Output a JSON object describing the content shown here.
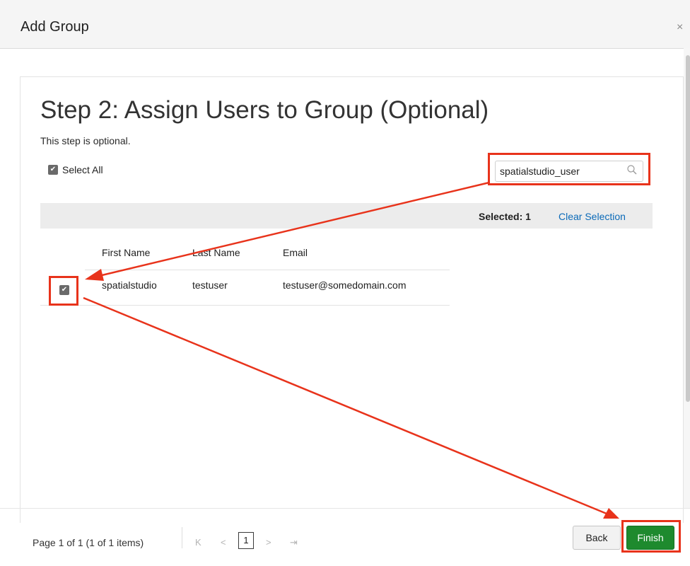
{
  "dialog": {
    "title": "Add Group",
    "close_label": "×"
  },
  "step": {
    "title": "Step 2: Assign Users to Group (Optional)",
    "subtitle": "This step is optional."
  },
  "select_all": {
    "label": "Select All",
    "checked": true
  },
  "search": {
    "value": "spatialstudio_user",
    "placeholder": ""
  },
  "selection": {
    "label": "Selected: 1",
    "clear_label": "Clear Selection"
  },
  "table": {
    "columns": [
      "First Name",
      "Last Name",
      "Email"
    ],
    "rows": [
      {
        "checked": true,
        "cells": [
          "spatialstudio",
          "testuser",
          "testuser@somedomain.com"
        ]
      }
    ]
  },
  "pagination": {
    "info": "Page  1  of 1   (1 of 1 items)",
    "first": "K",
    "prev": "<",
    "current": "1",
    "next": ">",
    "last": "⇥"
  },
  "buttons": {
    "back": "Back",
    "finish": "Finish"
  },
  "colors": {
    "finish_green": "#1e8a2e",
    "link_blue": "#0b6ab8",
    "annotation_red": "#e8331b"
  },
  "icons": {
    "search": "magnifier-icon",
    "close": "close-icon",
    "checkbox": "checkmark-icon"
  }
}
